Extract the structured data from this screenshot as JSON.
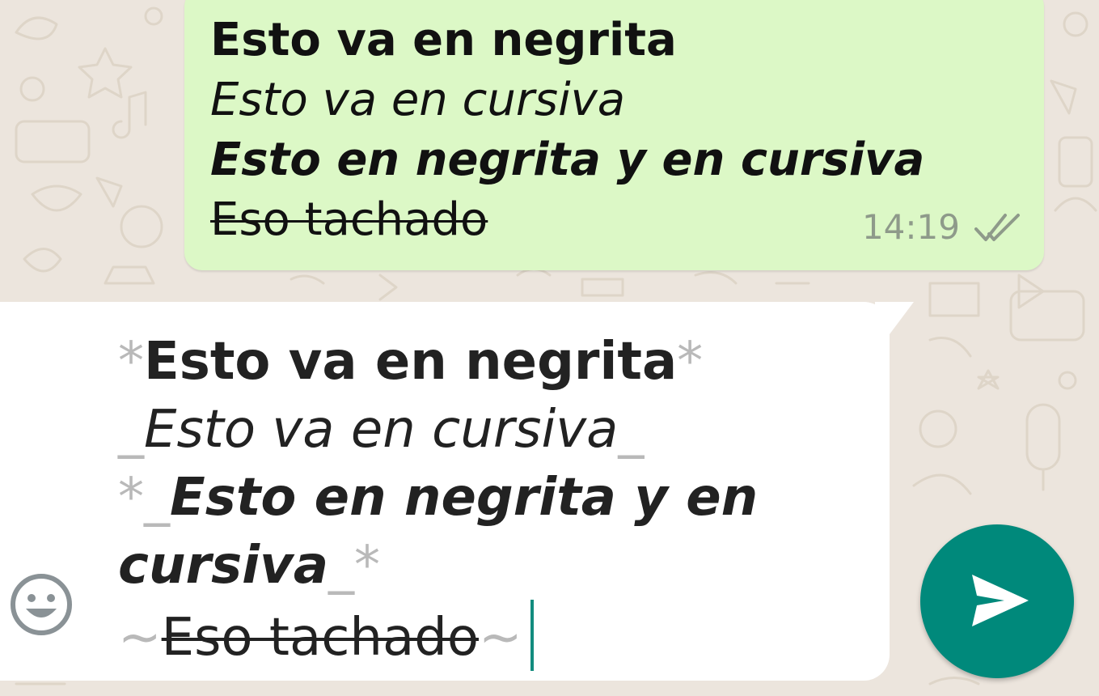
{
  "chat": {
    "sent_message": {
      "line_bold": "Esto va en negrita",
      "line_italic": "Esto va en cursiva",
      "line_bold_italic": "Esto en negrita y en cursiva",
      "line_strike": "Eso tachado",
      "time": "14:19",
      "status_icon": "double-check-icon"
    }
  },
  "composer": {
    "star": "*",
    "underscore": "_",
    "tilde": "~",
    "bold_text": "Esto va en negrita",
    "italic_text": "Esto va en cursiva",
    "bold_italic_line1": "Esto en negrita y en",
    "bold_italic_line2": "cursiva",
    "strike_text": "Eso tachado",
    "emoji_icon": "smiley-icon",
    "send_icon": "send-icon"
  },
  "colors": {
    "wallpaper": "#ece5dd",
    "sent_bubble": "#dcf8c6",
    "accent": "#00897b",
    "caret": "#128c7e",
    "markup_gray": "#b9b9b9"
  }
}
